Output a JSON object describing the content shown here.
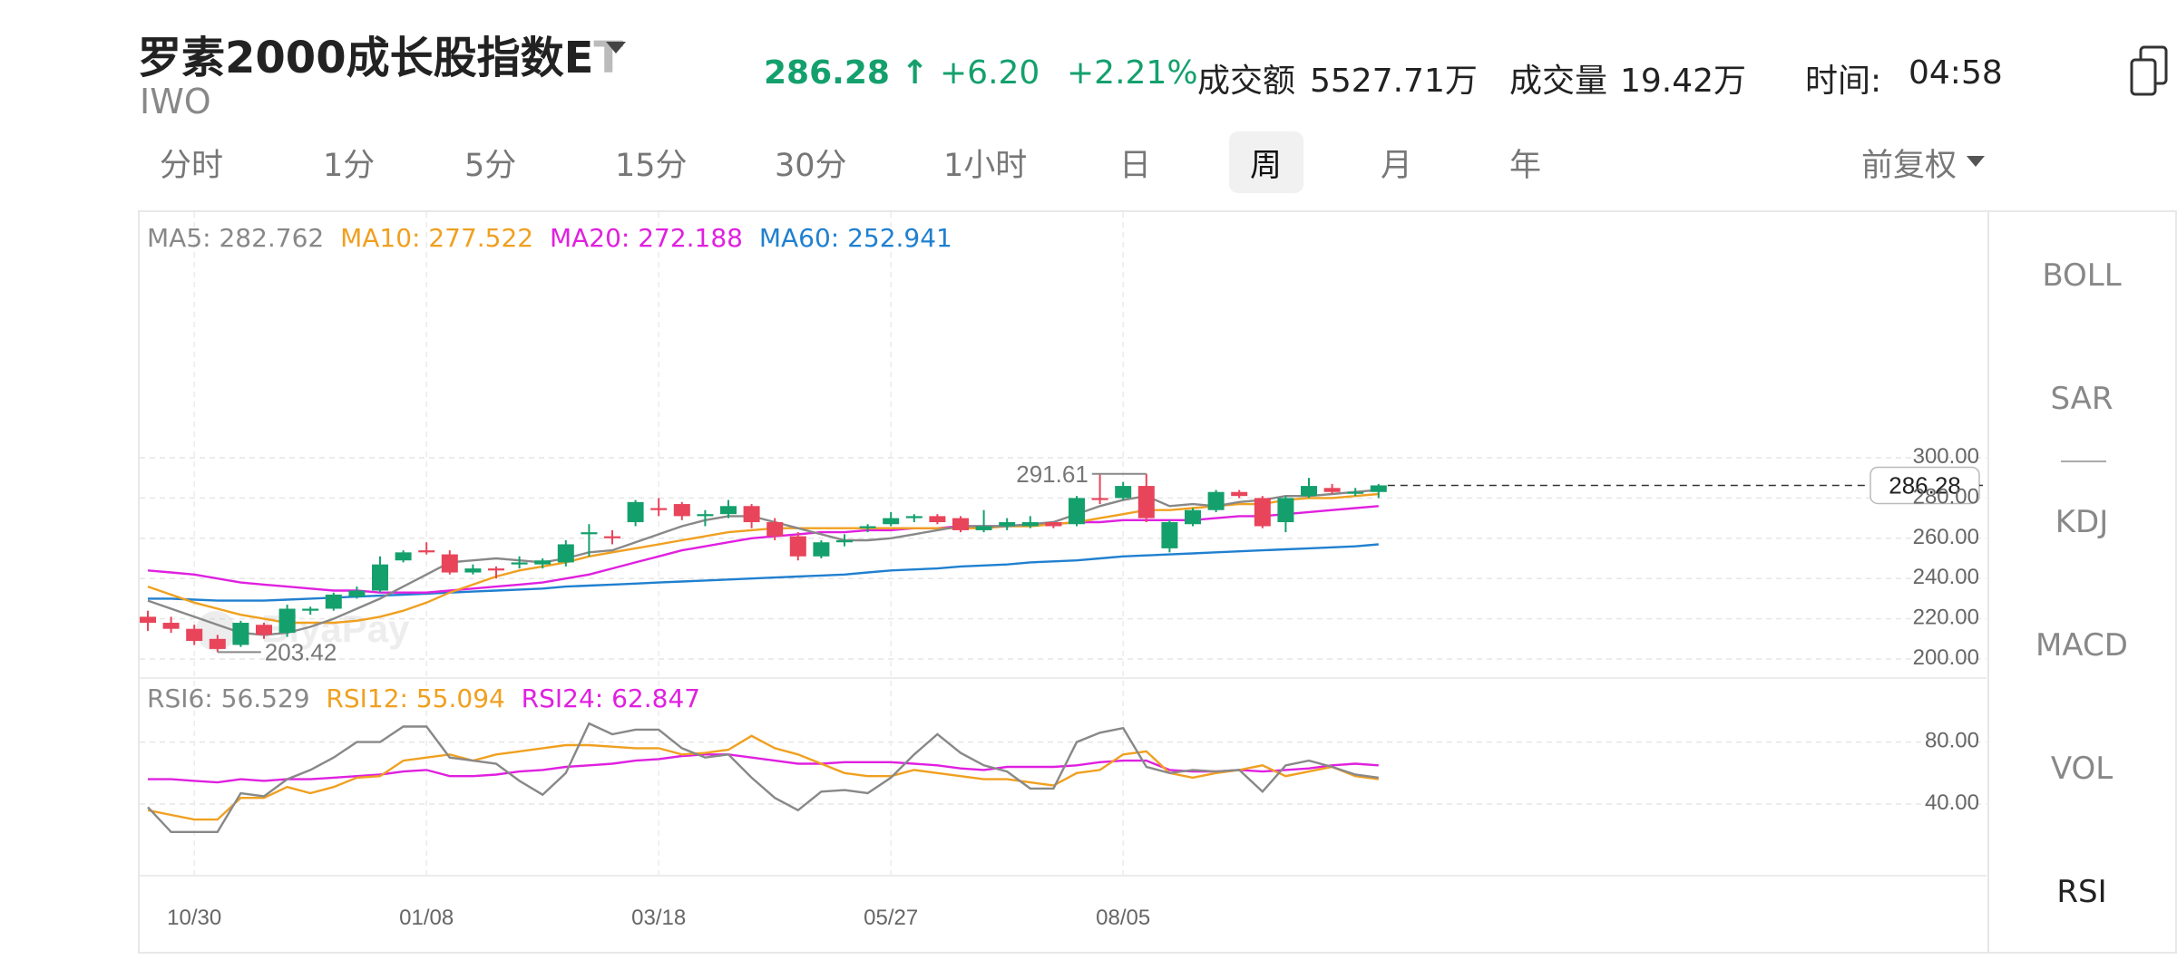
{
  "header": {
    "title": "罗素2000成长股指数E",
    "title_tail": "T",
    "ticker": "IWO",
    "price": "286.28",
    "price_arrow": "↑",
    "change": "+6.20",
    "change_pct": "+2.21%",
    "turnover_label": "成交额",
    "turnover_value": "5527.71万",
    "volume_label": "成交量",
    "volume_value": "19.42万",
    "time_label": "时间:",
    "time_value": "04:58",
    "up_color": "#14a06d",
    "down_color": "#e8445a"
  },
  "tabs": [
    "分时",
    "1分",
    "5分",
    "15分",
    "30分",
    "1小时",
    "日",
    "周",
    "月",
    "年"
  ],
  "active_tab": "周",
  "adjust_label": "前复权",
  "indicators": [
    "BOLL",
    "SAR",
    "KDJ",
    "MACD",
    "VOL",
    "RSI"
  ],
  "active_indicator": "RSI",
  "ma_legend": {
    "ma5": "MA5: 282.762",
    "ma10": "MA10: 277.522",
    "ma20": "MA20: 272.188",
    "ma60": "MA60: 252.941",
    "colors": {
      "ma5": "#888888",
      "ma10": "#f0a020",
      "ma20": "#e020e0",
      "ma60": "#2080d0"
    }
  },
  "rsi_legend": {
    "rsi6": "RSI6: 56.529",
    "rsi12": "RSI12: 55.094",
    "rsi24": "RSI24: 62.847"
  },
  "watermark": "BiyaPay",
  "chart_data": {
    "type": "candlestick",
    "price_axis": {
      "ticks": [
        "300.00",
        "280.00",
        "260.00",
        "240.00",
        "220.00",
        "200.00"
      ],
      "ylim": [
        200,
        300
      ]
    },
    "rsi_axis": {
      "ticks": [
        "80.00",
        "40.00"
      ]
    },
    "x_ticks": [
      "10/30",
      "01/08",
      "03/18",
      "05/27",
      "08/05"
    ],
    "high_label": "291.61",
    "low_label": "203.42",
    "last_price_label": "286.28",
    "candles": [
      {
        "o": 221,
        "c": 218,
        "h": 224,
        "l": 214
      },
      {
        "o": 218,
        "c": 215,
        "h": 221,
        "l": 213
      },
      {
        "o": 215,
        "c": 209,
        "h": 217,
        "l": 207
      },
      {
        "o": 210,
        "c": 205,
        "h": 212,
        "l": 203.42
      },
      {
        "o": 207,
        "c": 218,
        "h": 219,
        "l": 206
      },
      {
        "o": 217,
        "c": 212,
        "h": 218,
        "l": 210
      },
      {
        "o": 213,
        "c": 225,
        "h": 227,
        "l": 211
      },
      {
        "o": 224,
        "c": 225,
        "h": 226,
        "l": 222
      },
      {
        "o": 225,
        "c": 232,
        "h": 233,
        "l": 224
      },
      {
        "o": 231,
        "c": 234,
        "h": 236,
        "l": 230
      },
      {
        "o": 234,
        "c": 247,
        "h": 251,
        "l": 233
      },
      {
        "o": 249,
        "c": 253,
        "h": 254,
        "l": 248
      },
      {
        "o": 254,
        "c": 253,
        "h": 258,
        "l": 252
      },
      {
        "o": 252,
        "c": 243,
        "h": 254,
        "l": 242
      },
      {
        "o": 243,
        "c": 245,
        "h": 247,
        "l": 242
      },
      {
        "o": 245,
        "c": 244,
        "h": 246,
        "l": 240
      },
      {
        "o": 247,
        "c": 248,
        "h": 251,
        "l": 245
      },
      {
        "o": 247,
        "c": 249,
        "h": 250,
        "l": 245
      },
      {
        "o": 248,
        "c": 257,
        "h": 259,
        "l": 246
      },
      {
        "o": 262,
        "c": 263,
        "h": 267,
        "l": 251
      },
      {
        "o": 261,
        "c": 260,
        "h": 264,
        "l": 257
      },
      {
        "o": 268,
        "c": 278,
        "h": 279,
        "l": 266
      },
      {
        "o": 275,
        "c": 274,
        "h": 280,
        "l": 271
      },
      {
        "o": 277,
        "c": 271,
        "h": 278,
        "l": 269
      },
      {
        "o": 271,
        "c": 272,
        "h": 274,
        "l": 266
      },
      {
        "o": 272,
        "c": 276,
        "h": 279,
        "l": 270
      },
      {
        "o": 276,
        "c": 268,
        "h": 277,
        "l": 265
      },
      {
        "o": 268,
        "c": 261,
        "h": 270,
        "l": 259
      },
      {
        "o": 261,
        "c": 251,
        "h": 263,
        "l": 249
      },
      {
        "o": 251,
        "c": 258,
        "h": 259,
        "l": 250
      },
      {
        "o": 258,
        "c": 259,
        "h": 262,
        "l": 256
      },
      {
        "o": 265,
        "c": 266,
        "h": 267,
        "l": 263
      },
      {
        "o": 267,
        "c": 270,
        "h": 273,
        "l": 266
      },
      {
        "o": 270,
        "c": 271,
        "h": 272,
        "l": 268
      },
      {
        "o": 271,
        "c": 268,
        "h": 272,
        "l": 267
      },
      {
        "o": 270,
        "c": 264,
        "h": 271,
        "l": 263
      },
      {
        "o": 264,
        "c": 266,
        "h": 274,
        "l": 263
      },
      {
        "o": 266,
        "c": 268,
        "h": 270,
        "l": 264
      },
      {
        "o": 266,
        "c": 268,
        "h": 271,
        "l": 265
      },
      {
        "o": 268,
        "c": 266,
        "h": 268,
        "l": 265
      },
      {
        "o": 267,
        "c": 280,
        "h": 281,
        "l": 266
      },
      {
        "o": 280,
        "c": 279,
        "h": 291.61,
        "l": 277
      },
      {
        "o": 280,
        "c": 286,
        "h": 288,
        "l": 279
      },
      {
        "o": 286,
        "c": 270,
        "h": 292,
        "l": 268
      },
      {
        "o": 255,
        "c": 268,
        "h": 269,
        "l": 253
      },
      {
        "o": 267,
        "c": 274,
        "h": 275,
        "l": 266
      },
      {
        "o": 274,
        "c": 283,
        "h": 284,
        "l": 273
      },
      {
        "o": 283,
        "c": 281,
        "h": 284,
        "l": 280
      },
      {
        "o": 280,
        "c": 266,
        "h": 281,
        "l": 265
      },
      {
        "o": 268,
        "c": 280,
        "h": 281,
        "l": 263
      },
      {
        "o": 281,
        "c": 286,
        "h": 290,
        "l": 280
      },
      {
        "o": 285,
        "c": 283,
        "h": 287,
        "l": 282
      },
      {
        "o": 283,
        "c": 283,
        "h": 285,
        "l": 281
      },
      {
        "o": 283,
        "c": 286.28,
        "h": 287,
        "l": 280
      }
    ],
    "ma5": [
      229,
      225,
      221,
      217,
      213,
      212,
      213,
      216,
      220,
      225,
      230,
      236,
      242,
      248,
      249,
      250,
      249,
      248,
      250,
      253,
      254,
      258,
      262,
      266,
      269,
      271,
      271,
      268,
      265,
      262,
      259,
      259,
      260,
      262,
      264,
      266,
      266,
      266,
      267,
      268,
      272,
      276,
      279,
      281,
      276,
      277,
      276,
      278,
      279,
      281,
      281,
      282,
      283,
      284
    ],
    "ma10": [
      236,
      232,
      228,
      225,
      222,
      220,
      218,
      218,
      218,
      219,
      221,
      224,
      228,
      233,
      237,
      241,
      244,
      246,
      248,
      251,
      253,
      255,
      257,
      259,
      261,
      263,
      264,
      265,
      265,
      265,
      265,
      265,
      265,
      265,
      265,
      265,
      265,
      266,
      266,
      267,
      268,
      270,
      272,
      274,
      274,
      275,
      276,
      277,
      277,
      279,
      280,
      280,
      281,
      282
    ],
    "ma20": [
      244,
      243,
      242,
      240,
      238,
      237,
      236,
      235,
      234,
      234,
      233,
      233,
      233,
      234,
      235,
      236,
      237,
      238,
      240,
      242,
      245,
      248,
      251,
      254,
      256,
      258,
      260,
      261,
      262,
      263,
      263,
      264,
      264,
      265,
      265,
      266,
      266,
      266,
      267,
      267,
      268,
      268,
      269,
      269,
      269,
      269,
      270,
      271,
      271,
      272,
      273,
      274,
      275,
      276
    ],
    "ma60": [
      230,
      230,
      229.5,
      229,
      229,
      229,
      229.5,
      230,
      230.5,
      231,
      231.5,
      232,
      232.5,
      233,
      233.5,
      234,
      234.5,
      235,
      236,
      236.5,
      237,
      237.5,
      238,
      238.5,
      239,
      239.5,
      240,
      240.5,
      241,
      241.5,
      242,
      243,
      244,
      244.5,
      245,
      246,
      246.5,
      247,
      248,
      248.5,
      249,
      250,
      251,
      251.5,
      252,
      252.5,
      253,
      253.5,
      254,
      254.5,
      255,
      255.5,
      256,
      257
    ],
    "rsi6": [
      38,
      22,
      22,
      22,
      47,
      45,
      56,
      62,
      70,
      80,
      80,
      90,
      90,
      70,
      68,
      66,
      55,
      46,
      60,
      92,
      85,
      88,
      88,
      76,
      70,
      72,
      57,
      44,
      36,
      48,
      49,
      47,
      57,
      72,
      85,
      73,
      65,
      61,
      50,
      50,
      80,
      86,
      89,
      64,
      60,
      62,
      61,
      62,
      48,
      65,
      68,
      64,
      59,
      57
    ],
    "rsi12": [
      36,
      33,
      30,
      30,
      44,
      44,
      51,
      47,
      51,
      57,
      58,
      68,
      70,
      72,
      68,
      72,
      74,
      76,
      78,
      78,
      77,
      76,
      76,
      72,
      73,
      75,
      84,
      76,
      72,
      66,
      60,
      58,
      58,
      62,
      60,
      58,
      56,
      56,
      54,
      52,
      60,
      62,
      72,
      74,
      60,
      57,
      60,
      62,
      65,
      58,
      61,
      64,
      58,
      56
    ],
    "rsi24": [
      56,
      56,
      55,
      54,
      56,
      55,
      56,
      56,
      57,
      58,
      59,
      61,
      62,
      58,
      58,
      59,
      61,
      62,
      64,
      65,
      66,
      68,
      69,
      71,
      72,
      72,
      70,
      68,
      66,
      66,
      67,
      67,
      67,
      66,
      65,
      63,
      62,
      64,
      64,
      64,
      65,
      67,
      68,
      68,
      62,
      61,
      61,
      62,
      61,
      62,
      63,
      65,
      66,
      65
    ]
  }
}
